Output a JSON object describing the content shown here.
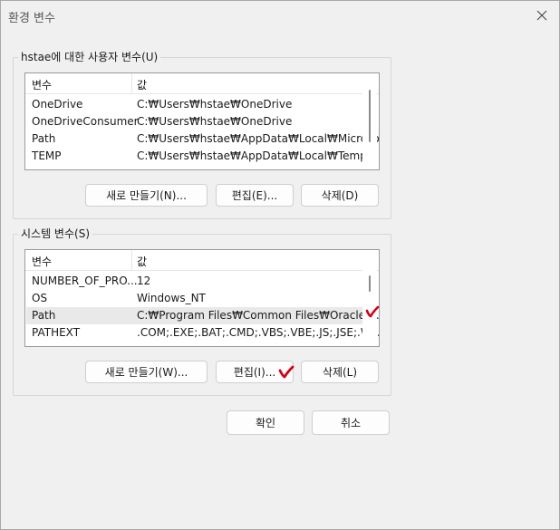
{
  "window": {
    "title": "환경 변수"
  },
  "user_group": {
    "label": "hstae에 대한 사용자 변수(U)",
    "headers": [
      "변수",
      "값"
    ],
    "rows": [
      {
        "name": "OneDrive",
        "value": "C:₩Users₩hstae₩OneDrive"
      },
      {
        "name": "OneDriveConsumer",
        "value": "C:₩Users₩hstae₩OneDrive"
      },
      {
        "name": "Path",
        "value": "C:₩Users₩hstae₩AppData₩Local₩Microsof..."
      },
      {
        "name": "TEMP",
        "value": "C:₩Users₩hstae₩AppData₩Local₩Temp"
      }
    ],
    "buttons": {
      "new": "새로 만들기(N)...",
      "edit": "편집(E)...",
      "delete": "삭제(D)"
    }
  },
  "system_group": {
    "label": "시스템 변수(S)",
    "headers": [
      "변수",
      "값"
    ],
    "rows": [
      {
        "name": "NUMBER_OF_PRO...",
        "value": "12"
      },
      {
        "name": "OS",
        "value": "Windows_NT"
      },
      {
        "name": "Path",
        "value": "C:₩Program Files₩Common Files₩Oracle₩..."
      },
      {
        "name": "PATHEXT",
        "value": ".COM;.EXE;.BAT;.CMD;.VBS;.VBE;.JS;.JSE;.W..."
      }
    ],
    "selected_row": 2,
    "buttons": {
      "new": "새로 만들기(W)...",
      "edit": "편집(I)...",
      "delete": "삭제(L)"
    }
  },
  "footer": {
    "ok": "확인",
    "cancel": "취소"
  },
  "colors": {
    "annotation": "#d0021b",
    "selected_row": "#e9e9e9"
  }
}
